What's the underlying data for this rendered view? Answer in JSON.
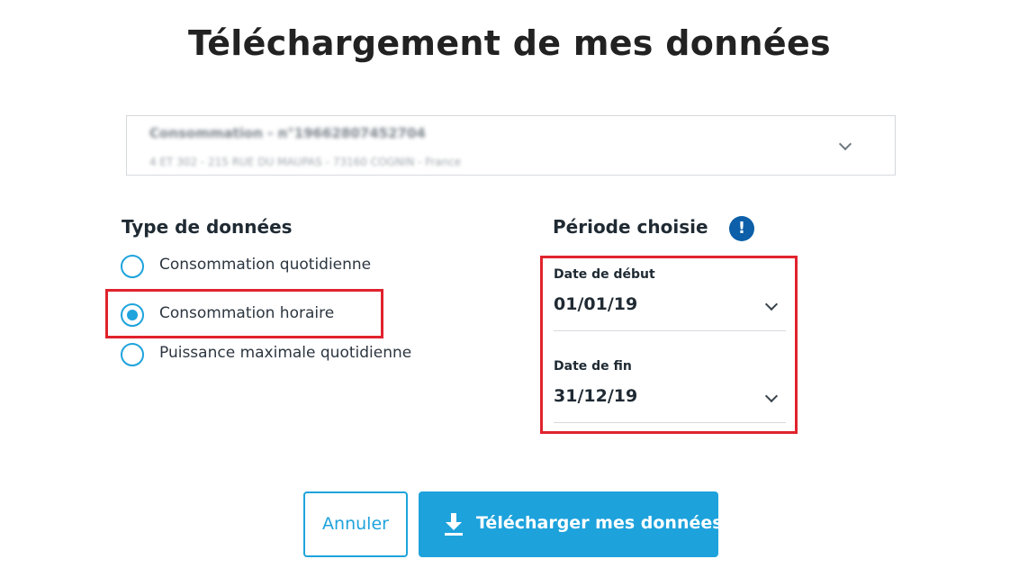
{
  "dialog": {
    "title": "Téléchargement de mes données"
  },
  "account_select": {
    "line1": "Consommation - n°19662807452704",
    "line2": "4 ET 302 - 215 RUE DU MAUPAS - 73160 COGNIN - France"
  },
  "data_type": {
    "title": "Type de données",
    "options": [
      {
        "label": "Consommation quotidienne",
        "checked": false
      },
      {
        "label": "Consommation horaire",
        "checked": true
      },
      {
        "label": "Puissance maximale quotidienne",
        "checked": false
      }
    ]
  },
  "period": {
    "title": "Période choisie",
    "info_icon": "!",
    "start": {
      "label": "Date de début",
      "value": "01/01/19"
    },
    "end": {
      "label": "Date de fin",
      "value": "31/12/19"
    }
  },
  "actions": {
    "cancel_label": "Annuler",
    "download_label": "Télécharger mes données"
  },
  "colors": {
    "accent": "#1da2dc",
    "info": "#0c5fa8",
    "highlight": "#e0232d"
  }
}
